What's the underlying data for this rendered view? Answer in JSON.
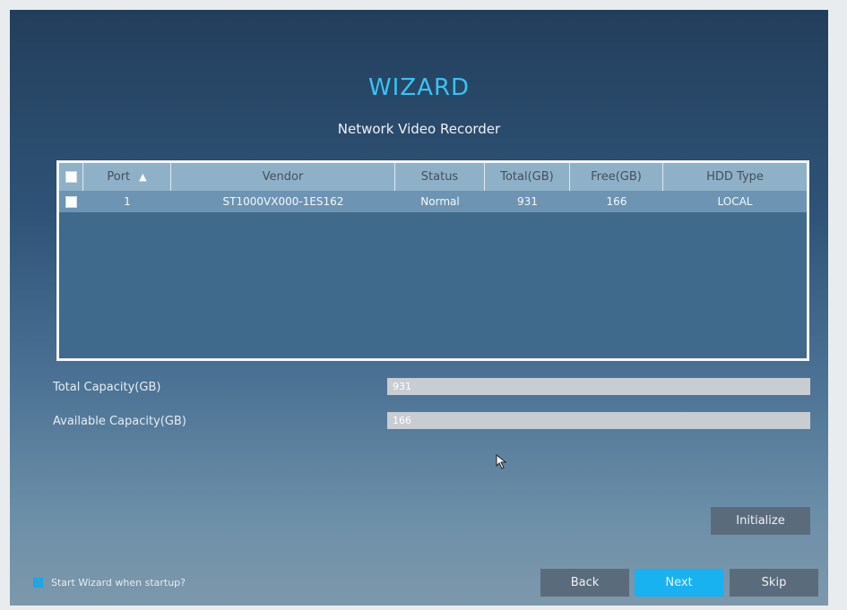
{
  "header": {
    "title": "WIZARD",
    "subtitle": "Network Video Recorder"
  },
  "table": {
    "columns": [
      "Port",
      "Vendor",
      "Status",
      "Total(GB)",
      "Free(GB)",
      "HDD Type"
    ],
    "sort_indicator": "▲",
    "rows": [
      {
        "port": "1",
        "vendor": "ST1000VX000-1ES162",
        "status": "Normal",
        "total": "931",
        "free": "166",
        "hdd_type": "LOCAL"
      }
    ]
  },
  "fields": {
    "total_label": "Total Capacity(GB)",
    "total_value": "931",
    "available_label": "Available Capacity(GB)",
    "available_value": "166"
  },
  "buttons": {
    "initialize": "Initialize",
    "back": "Back",
    "next": "Next",
    "skip": "Skip"
  },
  "footer": {
    "startup_label": "Start Wizard when startup?"
  },
  "colors": {
    "accent": "#17b2ef",
    "title": "#39c3f2"
  }
}
